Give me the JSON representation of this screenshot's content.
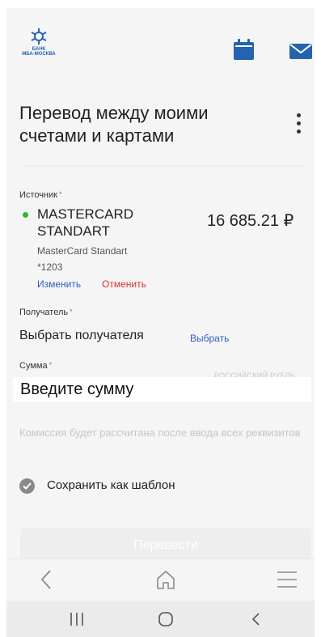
{
  "header": {
    "logo_text_line1": "БАНК",
    "logo_text_line2": "МБА-МОСКВА",
    "logo_icon": "bank-logo-icon",
    "calendar_icon": "calendar-icon",
    "mail_icon": "mail-icon",
    "accent_color": "#2563b0"
  },
  "page": {
    "title": "Перевод между моими счетами и картами",
    "menu_icon": "more-vertical-icon"
  },
  "source": {
    "label": "Источник",
    "required_mark": "*",
    "card_name": "MASTERCARD STANDART",
    "balance": "16 685.21 ₽",
    "card_type": "MasterCard Standart",
    "card_number": "*1203",
    "change_link": "Изменить",
    "cancel_link": "Отменить",
    "status_color": "#2eb82e"
  },
  "recipient": {
    "label": "Получатель",
    "required_mark": "*",
    "value": "Выбрать получателя",
    "select_link": "Выбрать"
  },
  "sum": {
    "label": "Сумма",
    "required_mark": "*",
    "currency": "РОССИЙСКИЙ РУБЛЬ",
    "placeholder": "Введите сумму"
  },
  "commission_note": "Комиссия будет рассчитана после ввода всех реквизитов",
  "save_template": {
    "label": "Сохранить как шаблон",
    "checked": true
  },
  "submit": {
    "label": "Перевести"
  },
  "app_nav": {
    "back_icon": "back-chevron-icon",
    "home_icon": "home-icon",
    "menu_icon": "hamburger-menu-icon"
  },
  "system_nav": {
    "recents_icon": "recents-icon",
    "home_icon": "home-circle-icon",
    "back_icon": "back-icon"
  }
}
